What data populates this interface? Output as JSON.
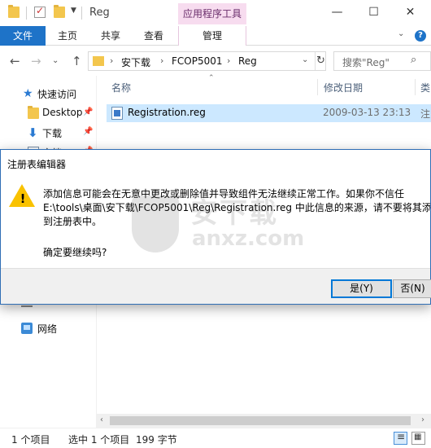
{
  "window": {
    "title": "Reg",
    "context_tab_group": "应用程序工具",
    "minimize_glyph": "—",
    "maximize_glyph": "☐",
    "close_glyph": "✕"
  },
  "ribbon": {
    "file_tab": "文件",
    "tabs": [
      "主页",
      "共享",
      "查看"
    ],
    "context_tab": "管理",
    "collapse_glyph": "⌄",
    "help_glyph": "?"
  },
  "address": {
    "back_glyph": "←",
    "forward_glyph": "→",
    "recent_glyph": "⌄",
    "up_glyph": "↑",
    "crumbs": [
      "安下载",
      "FCOP5001",
      "Reg"
    ],
    "crumb_sep": "›",
    "dropdown_glyph": "⌄",
    "refresh_glyph": "↻",
    "search_placeholder": "搜索\"Reg\"",
    "search_glyph": "⌕"
  },
  "nav": {
    "quick_access": "快速访问",
    "items": [
      {
        "label": "Desktop",
        "icon": "folder-icon"
      },
      {
        "label": "下载",
        "icon": "download-icon"
      },
      {
        "label": "文档",
        "icon": "document-icon"
      }
    ],
    "pin_glyph": "📌",
    "network": "网络"
  },
  "list": {
    "columns": [
      "名称",
      "修改日期",
      "类"
    ],
    "sort_glyph": "⌃",
    "files": [
      {
        "name": "Registration.reg",
        "modified": "2009-03-13 23:13",
        "type": "注"
      }
    ]
  },
  "scrollbar": {
    "left_glyph": "‹",
    "right_glyph": "›"
  },
  "status": {
    "item_count": "1 个项目",
    "selection": "选中 1 个项目",
    "size": "199 字节"
  },
  "dialog": {
    "title": "注册表编辑器",
    "warning_glyph": "!",
    "message_lines": [
      "添加信息可能会在无意中更改或删除值并导致组件无法继续正常工作。如果你不信任",
      "E:\\tools\\桌面\\安下载\\FCOP5001\\Reg\\Registration.reg 中此信息的来源，请不要将其添",
      "到注册表中。"
    ],
    "question": "确定要继续吗?",
    "yes_label": "是(Y)",
    "no_label": "否(N)"
  },
  "watermark": {
    "cn": "安下载",
    "en": "anxz.com"
  }
}
